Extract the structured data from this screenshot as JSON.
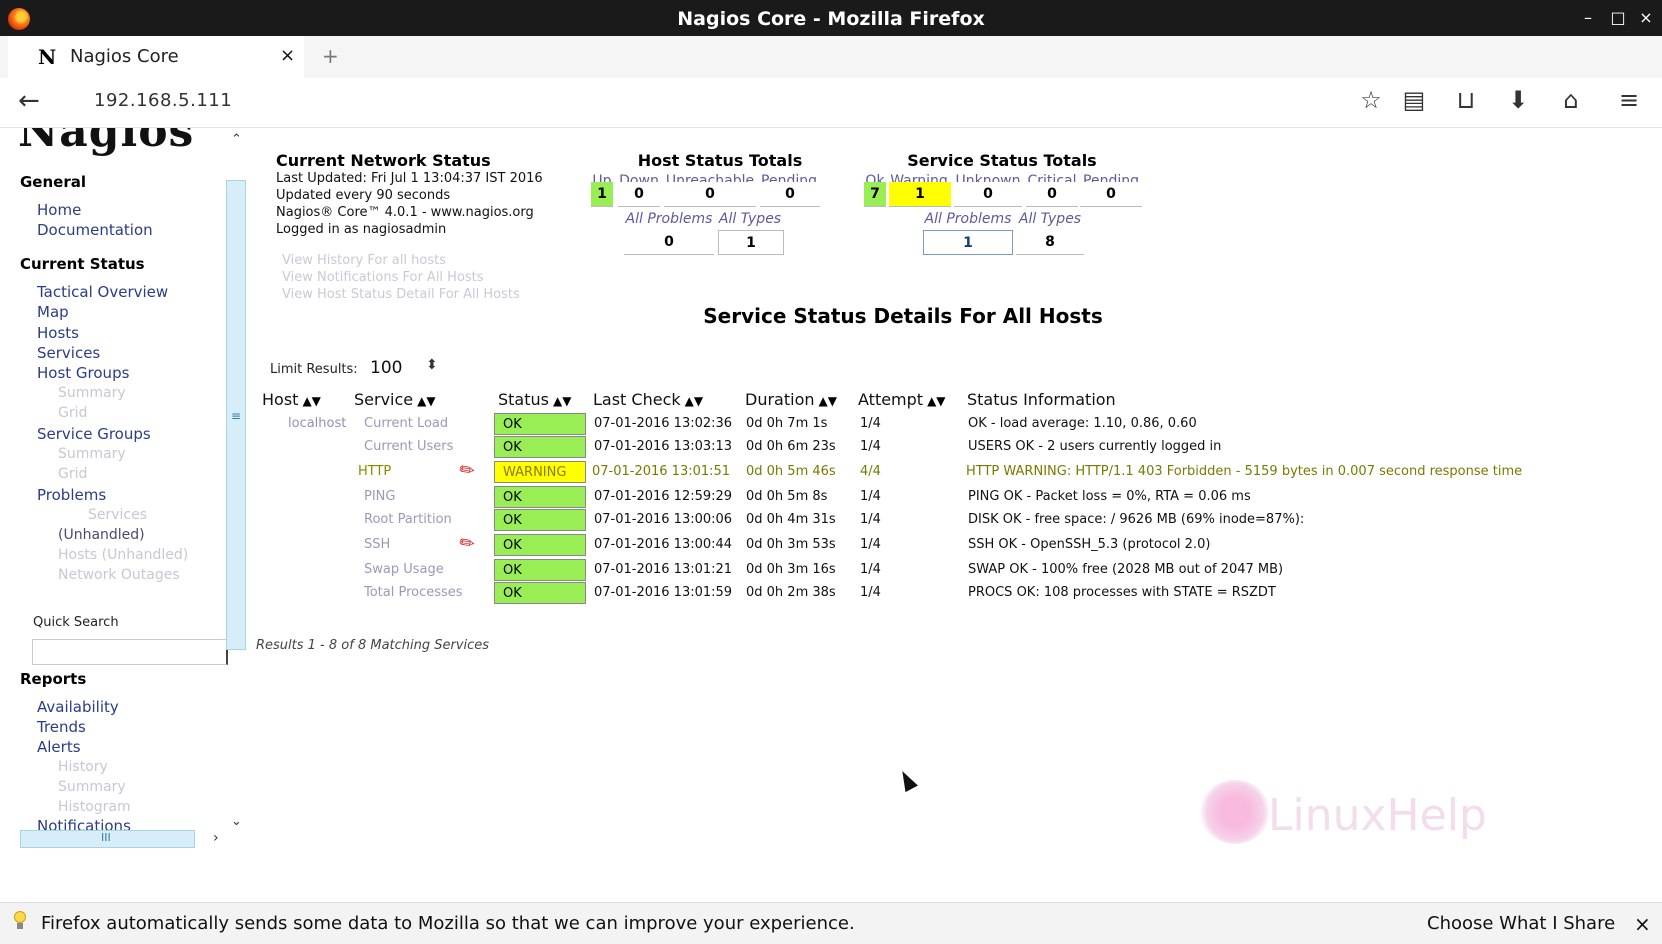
{
  "window": {
    "title": "Nagios Core - Mozilla Firefox",
    "minimize": "–",
    "maximize": "□",
    "close": "×"
  },
  "tab": {
    "icon": "N",
    "label": "Nagios Core",
    "close": "×",
    "new_tab": "+"
  },
  "nav": {
    "back": "←",
    "url": "192.168.5.111",
    "bookmark": "☆",
    "reader": "▤",
    "pocket": "⊔",
    "download": "⬇",
    "home": "⌂",
    "menu": "≡"
  },
  "sidebar": {
    "logo": "Nagios",
    "general": {
      "title": "General",
      "items": [
        {
          "label": "Home"
        },
        {
          "label": "Documentation"
        }
      ]
    },
    "current_status": {
      "title": "Current Status",
      "tactical_overview": "Tactical Overview",
      "map": "Map",
      "hosts": "Hosts",
      "services": "Services",
      "host_groups": "Host Groups",
      "hg_summary": "Summary",
      "hg_grid": "Grid",
      "service_groups": "Service Groups",
      "sg_summary": "Summary",
      "sg_grid": "Grid",
      "problems": "Problems",
      "p_services": "Services",
      "p_unhandled": "(Unhandled)",
      "p_hosts": "Hosts (Unhandled)",
      "p_outages": "Network Outages"
    },
    "quick_search": {
      "label": "Quick Search",
      "value": ""
    },
    "reports": {
      "title": "Reports",
      "availability": "Availability",
      "trends": "Trends",
      "alerts": "Alerts",
      "history": "History",
      "summary": "Summary",
      "histogram": "Histogram",
      "notifications": "Notifications"
    }
  },
  "network_status": {
    "title": "Current Network Status",
    "last_updated": "Last Updated: Fri Jul 1 13:04:37 IST 2016",
    "update_every": "Updated every 90 seconds",
    "version": "Nagios® Core™ 4.0.1 - www.nagios.org",
    "logged_in": "Logged in as nagiosadmin",
    "link_history": "View History For all hosts",
    "link_notifications": "View Notifications For All Hosts",
    "link_host_detail": "View Host Status Detail For All Hosts"
  },
  "host_totals": {
    "title": "Host Status Totals",
    "headers": [
      "Up",
      "Down",
      "Unreachable",
      "Pending"
    ],
    "values": [
      "1",
      "0",
      "0",
      "0"
    ],
    "sub_headers": [
      "All Problems",
      "All Types"
    ],
    "sub_values": [
      "0",
      "1"
    ]
  },
  "service_totals": {
    "title": "Service Status Totals",
    "headers": [
      "Ok",
      "Warning",
      "Unknown",
      "Critical",
      "Pending"
    ],
    "values": [
      "7",
      "1",
      "0",
      "0",
      "0"
    ],
    "sub_headers": [
      "All Problems",
      "All Types"
    ],
    "sub_values": [
      "1",
      "8"
    ]
  },
  "details": {
    "title": "Service Status Details For All Hosts",
    "limit_label": "Limit Results:",
    "limit_value": "100",
    "columns": [
      "Host",
      "Service",
      "Status",
      "Last Check",
      "Duration",
      "Attempt",
      "Status Information"
    ],
    "rows": [
      {
        "host": "localhost",
        "service": "Current Load",
        "status": "OK",
        "last_check": "07-01-2016 13:02:36",
        "duration": "0d 0h 7m 1s",
        "attempt": "1/4",
        "info": "OK - load average: 1.10, 0.86, 0.60"
      },
      {
        "host": "",
        "service": "Current Users",
        "status": "OK",
        "last_check": "07-01-2016 13:03:13",
        "duration": "0d 0h 6m 23s",
        "attempt": "1/4",
        "info": "USERS OK - 2 users currently logged in"
      },
      {
        "host": "",
        "service": "HTTP",
        "status": "WARNING",
        "last_check": "07-01-2016 13:01:51",
        "duration": "0d 0h 5m 46s",
        "attempt": "4/4",
        "info": "HTTP WARNING: HTTP/1.1 403 Forbidden - 5159 bytes in 0.007 second response time"
      },
      {
        "host": "",
        "service": "PING",
        "status": "OK",
        "last_check": "07-01-2016 12:59:29",
        "duration": "0d 0h 5m 8s",
        "attempt": "1/4",
        "info": "PING OK - Packet loss = 0%, RTA = 0.06 ms"
      },
      {
        "host": "",
        "service": "Root Partition",
        "status": "OK",
        "last_check": "07-01-2016 13:00:06",
        "duration": "0d 0h 4m 31s",
        "attempt": "1/4",
        "info": "DISK OK - free space: / 9626 MB (69% inode=87%):"
      },
      {
        "host": "",
        "service": "SSH",
        "status": "OK",
        "last_check": "07-01-2016 13:00:44",
        "duration": "0d 0h 3m 53s",
        "attempt": "1/4",
        "info": "SSH OK - OpenSSH_5.3 (protocol 2.0)"
      },
      {
        "host": "",
        "service": "Swap Usage",
        "status": "OK",
        "last_check": "07-01-2016 13:01:21",
        "duration": "0d 0h 3m 16s",
        "attempt": "1/4",
        "info": "SWAP OK - 100% free (2028 MB out of 2047 MB)"
      },
      {
        "host": "",
        "service": "Total Processes",
        "status": "OK",
        "last_check": "07-01-2016 13:01:59",
        "duration": "0d 0h 2m 38s",
        "attempt": "1/4",
        "info": "PROCS OK: 108 processes with STATE = RSZDT"
      }
    ],
    "results": "Results 1 - 8 of 8 Matching Services"
  },
  "watermark": "LinuxHelp",
  "notification": {
    "text": "Firefox automatically sends some data to Mozilla so that we can improve your experience.",
    "choose": "Choose What I Share",
    "close": "×"
  },
  "colors": {
    "ok": "#99ee55",
    "warning": "#ffff00",
    "link": "#2a3c8a"
  }
}
